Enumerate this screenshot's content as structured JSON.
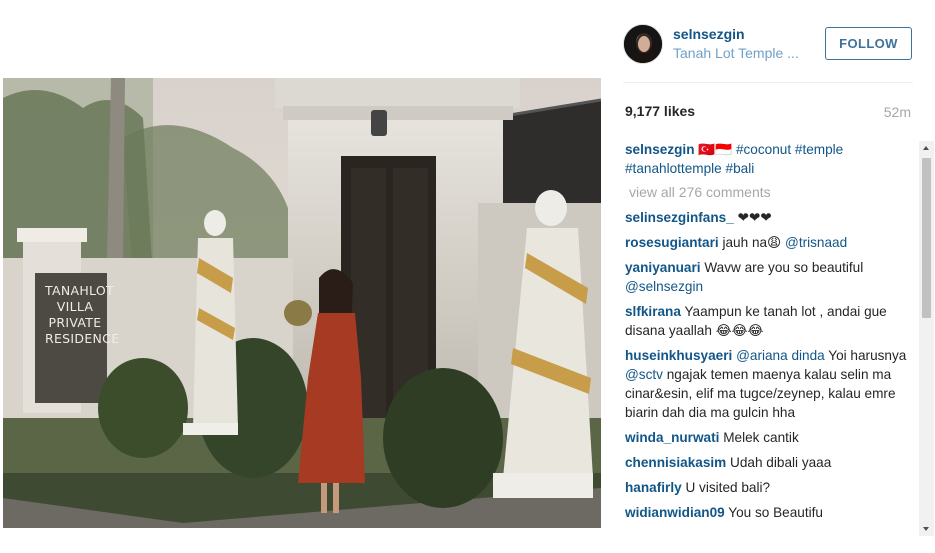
{
  "post": {
    "photo_alt": "",
    "sign_text": [
      "TANAHLOT",
      "VILLA",
      "PRIVATE",
      "RESIDENCE"
    ]
  },
  "header": {
    "username": "selnsezgin",
    "location": "Tanah Lot Temple ...",
    "follow_label": "FOLLOW"
  },
  "stats": {
    "likes": "9,177 likes",
    "age": "52m"
  },
  "caption": {
    "user": "selnsezgin",
    "emoji": "🇹🇷🇮🇩",
    "tags": "#coconut #temple #tanahlottemple #bali"
  },
  "view_all": "view all 276 comments",
  "comments": [
    {
      "user": "selinsezginfans_",
      "text": " ❤❤❤"
    },
    {
      "user": "rosesugiantari",
      "text": " jauh na😩 ",
      "tag": "@trisnaad"
    },
    {
      "user": "yaniyanuari",
      "text": " Wavw are you so beautiful ",
      "tag": "@selnsezgin"
    },
    {
      "user": "slfkirana",
      "text": " Yaampun ke tanah lot , andai gue disana yaallah 😂😂😂"
    },
    {
      "user": "huseinkhusyaeri",
      "text_html": [
        " ",
        {
          "tag": "@ariana"
        },
        " ",
        {
          "tag": "dinda"
        },
        " Yoi harusnya ",
        {
          "tag": "@sctv"
        },
        "  ngajak temen maenya kalau selin ma cinar&esin, elif ma tugce/zeynep, kalau emre biarin dah dia ma gulcin hha"
      ]
    },
    {
      "user": "winda_nurwati",
      "text": " Melek cantik"
    },
    {
      "user": "chennisiakasim",
      "text": " Udah dibali yaaa"
    },
    {
      "user": "hanafirly",
      "text": " U visited bali?"
    },
    {
      "user": "widianwidian09",
      "text": " You so Beautifu"
    }
  ],
  "colors": {
    "username": "#125688",
    "follow_border": "#3f729b",
    "muted": "#a5a7aa"
  },
  "icons": {
    "scroll_up": "triangle-up",
    "scroll_down": "triangle-down"
  }
}
